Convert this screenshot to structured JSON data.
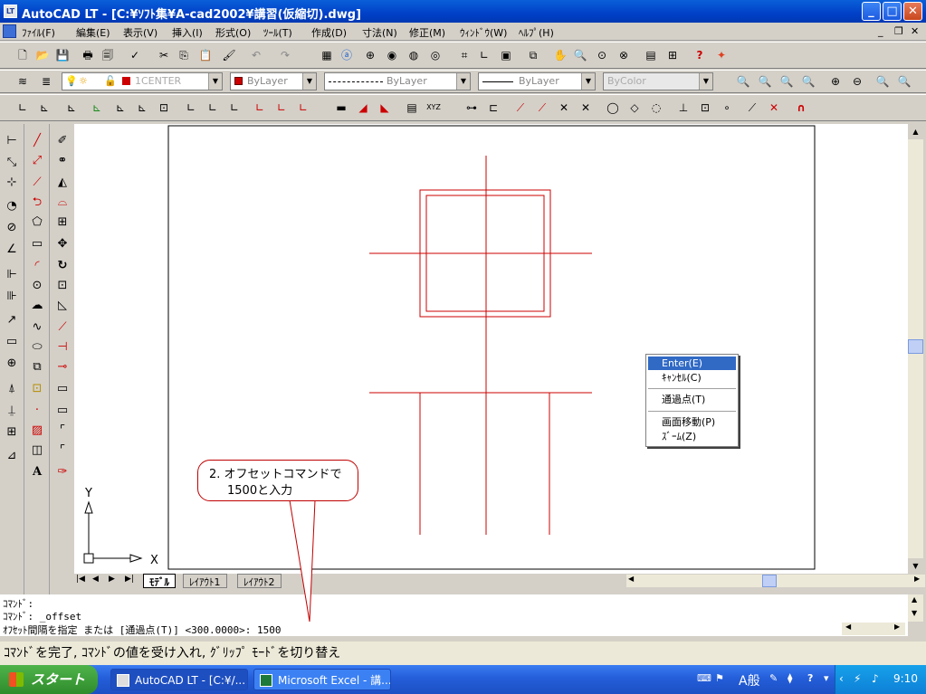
{
  "window": {
    "title": "AutoCAD LT - [C:¥ｿﾌﾄ集¥A-cad2002¥講習(仮縮切).dwg]",
    "app_icon": "autocad-app-icon"
  },
  "menubar": {
    "items": [
      "ﾌｧｲﾙ(F)",
      "編集(E)",
      "表示(V)",
      "挿入(I)",
      "形式(O)",
      "ﾂｰﾙ(T)",
      "作成(D)",
      "寸法(N)",
      "修正(M)",
      "ｳｨﾝﾄﾞｳ(W)",
      "ﾍﾙﾌﾟ(H)"
    ]
  },
  "layer_toolbar": {
    "layer": "1CENTER",
    "color": "ByLayer",
    "linetype": "ByLayer",
    "lineweight": "ByLayer",
    "plotstyle": "ByColor",
    "color_swatch": "#cc0000"
  },
  "drawing": {
    "line_color": "#cc0000",
    "axis_x": "X",
    "axis_y": "Y"
  },
  "layout_tabs": [
    "ﾓﾃﾞﾙ",
    "ﾚｲｱｳﾄ1",
    "ﾚｲｱｳﾄ2"
  ],
  "context_menu": {
    "items": [
      "Enter(E)",
      "ｷｬﾝｾﾙ(C)",
      "通過点(T)",
      "画面移動(P)",
      "ｽﾞｰﾑ(Z)"
    ],
    "selected": "Enter(E)"
  },
  "callout": {
    "line1": "2. オフセットコマンドで",
    "line2": "1500と入力"
  },
  "command": {
    "line1": "ｺﾏﾝﾄﾞ:",
    "line2": "ｺﾏﾝﾄﾞ: _offset",
    "line3": "ｵﾌｾｯﾄ間隔を指定 または [通過点(T)] <300.0000>: 1500"
  },
  "status": {
    "text": "ｺﾏﾝﾄﾞを完了, ｺﾏﾝﾄﾞの値を受け入れ, ｸﾞﾘｯﾌﾟ ﾓｰﾄﾞを切り替え"
  },
  "taskbar": {
    "start": "スタート",
    "items": [
      "AutoCAD LT - [C:¥/...",
      "Microsoft Excel - 講..."
    ],
    "ime": "A般",
    "clock": "9:10"
  }
}
